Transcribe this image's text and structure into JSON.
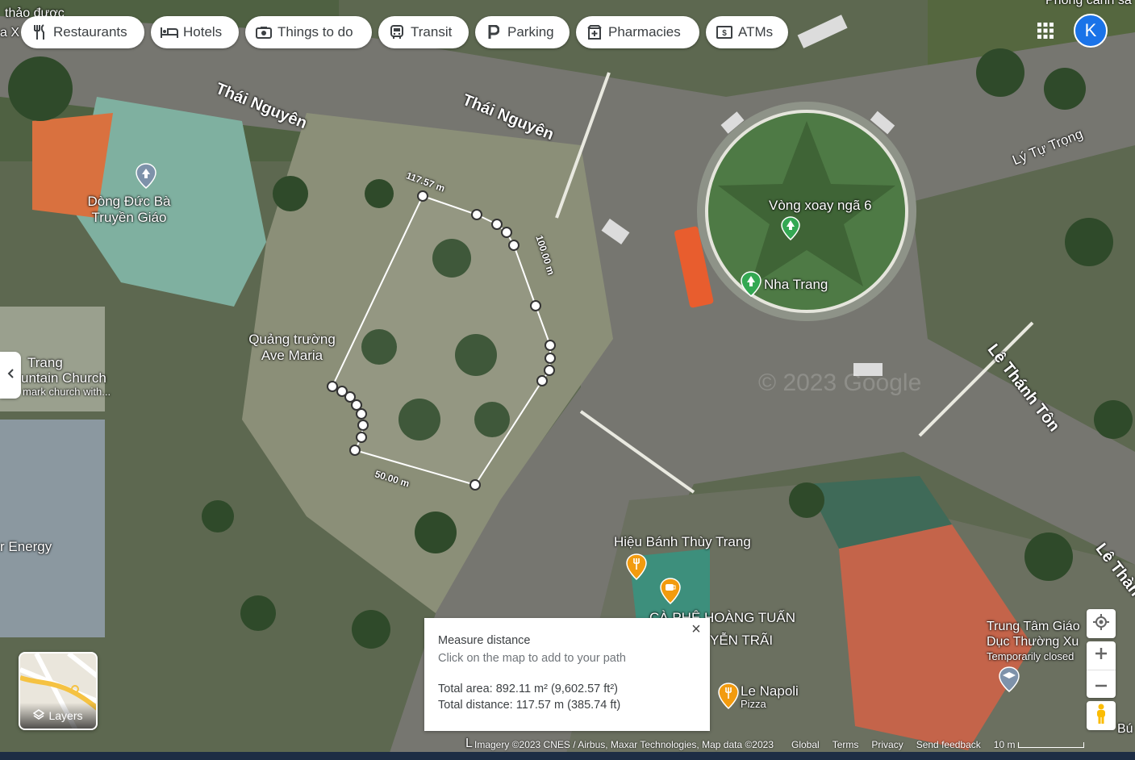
{
  "chips": [
    {
      "label": "Restaurants",
      "icon": "fork-knife-icon"
    },
    {
      "label": "Hotels",
      "icon": "bed-icon"
    },
    {
      "label": "Things to do",
      "icon": "camera-icon"
    },
    {
      "label": "Transit",
      "icon": "bus-icon"
    },
    {
      "label": "Parking",
      "icon": "parking-icon"
    },
    {
      "label": "Pharmacies",
      "icon": "pharmacy-icon"
    },
    {
      "label": "ATMs",
      "icon": "atm-icon"
    }
  ],
  "account": {
    "initial": "K",
    "color": "#1a73e8"
  },
  "roads": {
    "thai_nguyen_1": "Thái Nguyên",
    "thai_nguyen_2": "Thái Nguyên",
    "ly_tu_trong": "Lý Tự Trọng",
    "le_thanh_ton": "Lê Thánh Tôn",
    "le_thanh_edge": "Lê Thàn"
  },
  "places": {
    "dong_duc_ba": "Dòng Đức Bà\nTruyền Giáo",
    "quang_truong": "Quảng trường\nAve Maria",
    "vong_xoay": "Vòng xoay ngã 6",
    "nha_trang": "Nha Trang",
    "church_1": "Trang",
    "church_2": "untain Church",
    "church_3": "mark church with...",
    "energy": "r Energy",
    "hieu_banh": "Hiệu Bánh Thùy Trang",
    "ca_phe": "CÀ PHÊ HOÀNG TUẤN",
    "yen_trai": "YỄN TRÃI",
    "le_napoli": "Le Napoli",
    "pizza": "Pizza",
    "trung_tam_1": "Trung Tâm Giáo",
    "trung_tam_2": "Dục Thường Xu",
    "temp_closed": "Temporarily closed",
    "phong_canh": "Phong cảnh sa",
    "top_left_1": "thảo được",
    "top_left_2": "a X",
    "bottom_left": "L",
    "bottom_right_edge": "Bú",
    "watermark": "© 2023 Google"
  },
  "measure_labels": {
    "segment_top": "117.57 m",
    "segment_right": "100.00 m",
    "segment_bottom": "50.00 m"
  },
  "measure_panel": {
    "title": "Measure distance",
    "hint": "Click on the map to add to your path",
    "area": "Total area: 892.11 m² (9,602.57 ft²)",
    "distance": "Total distance: 117.57 m (385.74 ft)"
  },
  "layers": {
    "label": "Layers"
  },
  "footer": {
    "imagery": "Imagery ©2023 CNES / Airbus, Maxar Technologies, Map data ©2023",
    "global": "Global",
    "terms": "Terms",
    "privacy": "Privacy",
    "feedback": "Send feedback",
    "scale": "10 m"
  }
}
